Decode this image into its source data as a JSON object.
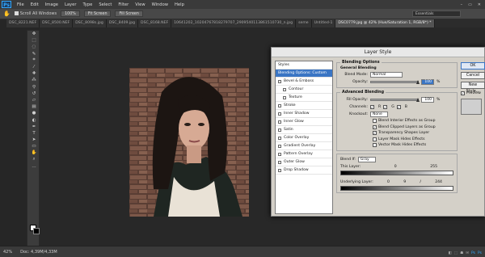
{
  "menubar": {
    "logo": "Ps",
    "items": [
      "File",
      "Edit",
      "Image",
      "Layer",
      "Type",
      "Select",
      "Filter",
      "View",
      "Window",
      "Help"
    ],
    "controls": [
      "–",
      "▭",
      "✕"
    ]
  },
  "optbar": {
    "scroll_all_label": "Scroll All Windows",
    "zoom_pct": "100%",
    "fit_screen": "Fit Screen",
    "fill_screen": "Fill Screen",
    "workspace": "Essentials"
  },
  "tabs": [
    "DSC_8221.NEF",
    "DSC_8500.NEF",
    "DSC_8098s.jpg",
    "DSC_8409.jpg",
    "DSC_8168.NEF",
    "10641202_10204767818279707_2909540113861510730_n.jpg",
    "seme",
    "Untitled-1",
    "DSC0779.jpg @ 42% (Hue/Saturation 1, RGB/8*) *"
  ],
  "status": {
    "zoom": "42%",
    "doc": "Doc: 4,39M/4,33M"
  },
  "taskbar": [
    "◧",
    "⬚",
    "☗",
    "✉",
    "Ps",
    "Ps"
  ],
  "dialog": {
    "title": "Layer Style",
    "styles": [
      {
        "label": "Styles",
        "checkbox": false,
        "active": false,
        "indent": false
      },
      {
        "label": "Blending Options: Custom",
        "checkbox": false,
        "active": true,
        "indent": false
      },
      {
        "label": "Bevel & Emboss",
        "checkbox": true,
        "active": false,
        "indent": false
      },
      {
        "label": "Contour",
        "checkbox": true,
        "active": false,
        "indent": true
      },
      {
        "label": "Texture",
        "checkbox": true,
        "active": false,
        "indent": true
      },
      {
        "label": "Stroke",
        "checkbox": true,
        "active": false,
        "indent": false
      },
      {
        "label": "Inner Shadow",
        "checkbox": true,
        "active": false,
        "indent": false
      },
      {
        "label": "Inner Glow",
        "checkbox": true,
        "active": false,
        "indent": false
      },
      {
        "label": "Satin",
        "checkbox": true,
        "active": false,
        "indent": false
      },
      {
        "label": "Color Overlay",
        "checkbox": true,
        "active": false,
        "indent": false
      },
      {
        "label": "Gradient Overlay",
        "checkbox": true,
        "active": false,
        "indent": false
      },
      {
        "label": "Pattern Overlay",
        "checkbox": true,
        "active": false,
        "indent": false
      },
      {
        "label": "Outer Glow",
        "checkbox": true,
        "active": false,
        "indent": false
      },
      {
        "label": "Drop Shadow",
        "checkbox": true,
        "active": false,
        "indent": false
      }
    ],
    "blending": {
      "section": "Blending Options",
      "general": "General Blending",
      "blend_mode_label": "Blend Mode:",
      "blend_mode": "Normal",
      "opacity_label": "Opacity:",
      "opacity": "100",
      "pct": "%",
      "advanced": "Advanced Blending",
      "fill_opacity_label": "Fill Opacity:",
      "fill_opacity": "100",
      "channels_label": "Channels:",
      "channel_r": "R",
      "channel_g": "G",
      "channel_b": "B",
      "knockout_label": "Knockout:",
      "knockout": "None",
      "check_options": [
        {
          "label": "Blend Interior Effects as Group",
          "checked": false
        },
        {
          "label": "Blend Clipped Layers as Group",
          "checked": true
        },
        {
          "label": "Transparency Shapes Layer",
          "checked": true
        },
        {
          "label": "Layer Mask Hides Effects",
          "checked": false
        },
        {
          "label": "Vector Mask Hides Effects",
          "checked": false
        }
      ],
      "blend_if_label": "Blend If:",
      "blend_if": "Gray",
      "this_layer_label": "This Layer:",
      "this_layer_min": "0",
      "this_layer_max": "255",
      "underlying_label": "Underlying Layer:",
      "underlying_min": "0",
      "underlying_mid": "9",
      "underlying_sep": "/",
      "underlying_max": "244"
    },
    "buttons": {
      "ok": "OK",
      "cancel": "Cancel",
      "new_style": "New Style...",
      "preview": "Preview"
    }
  }
}
